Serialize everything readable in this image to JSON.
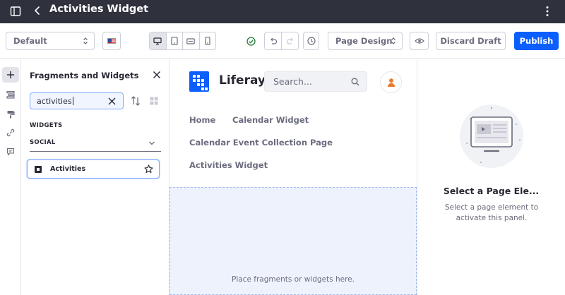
{
  "header": {
    "title": "Activities Widget"
  },
  "toolbar": {
    "experience_select": "Default",
    "language_flag": "en-US",
    "devices": [
      "desktop",
      "tablet",
      "landscape",
      "portrait"
    ],
    "active_device": "desktop",
    "page_design_select": "Page Design",
    "discard_label": "Discard Draft",
    "publish_label": "Publish"
  },
  "sidebar_rail": {
    "items": [
      "add-icon",
      "browser-icon",
      "paint-icon",
      "link-icon",
      "comments-icon"
    ],
    "active": "add-icon"
  },
  "fragments_panel": {
    "title": "Fragments and Widgets",
    "search_value": "activities",
    "section_label": "WIDGETS",
    "category_label": "SOCIAL",
    "widgets": [
      {
        "label": "Activities"
      }
    ]
  },
  "canvas": {
    "site_name": "Liferay",
    "search_placeholder": "Search...",
    "nav": [
      "Home",
      "Calendar Widget",
      "Calendar Event Collection Page",
      "Activities Widget"
    ],
    "drop_text": "Place fragments or widgets here."
  },
  "right_panel": {
    "title": "Select a Page Ele...",
    "description": "Select a page element to activate this panel."
  },
  "colors": {
    "primary": "#0b5fff",
    "topbar": "#2f313d",
    "success": "#287d3c",
    "avatar": "#e87a2e"
  }
}
